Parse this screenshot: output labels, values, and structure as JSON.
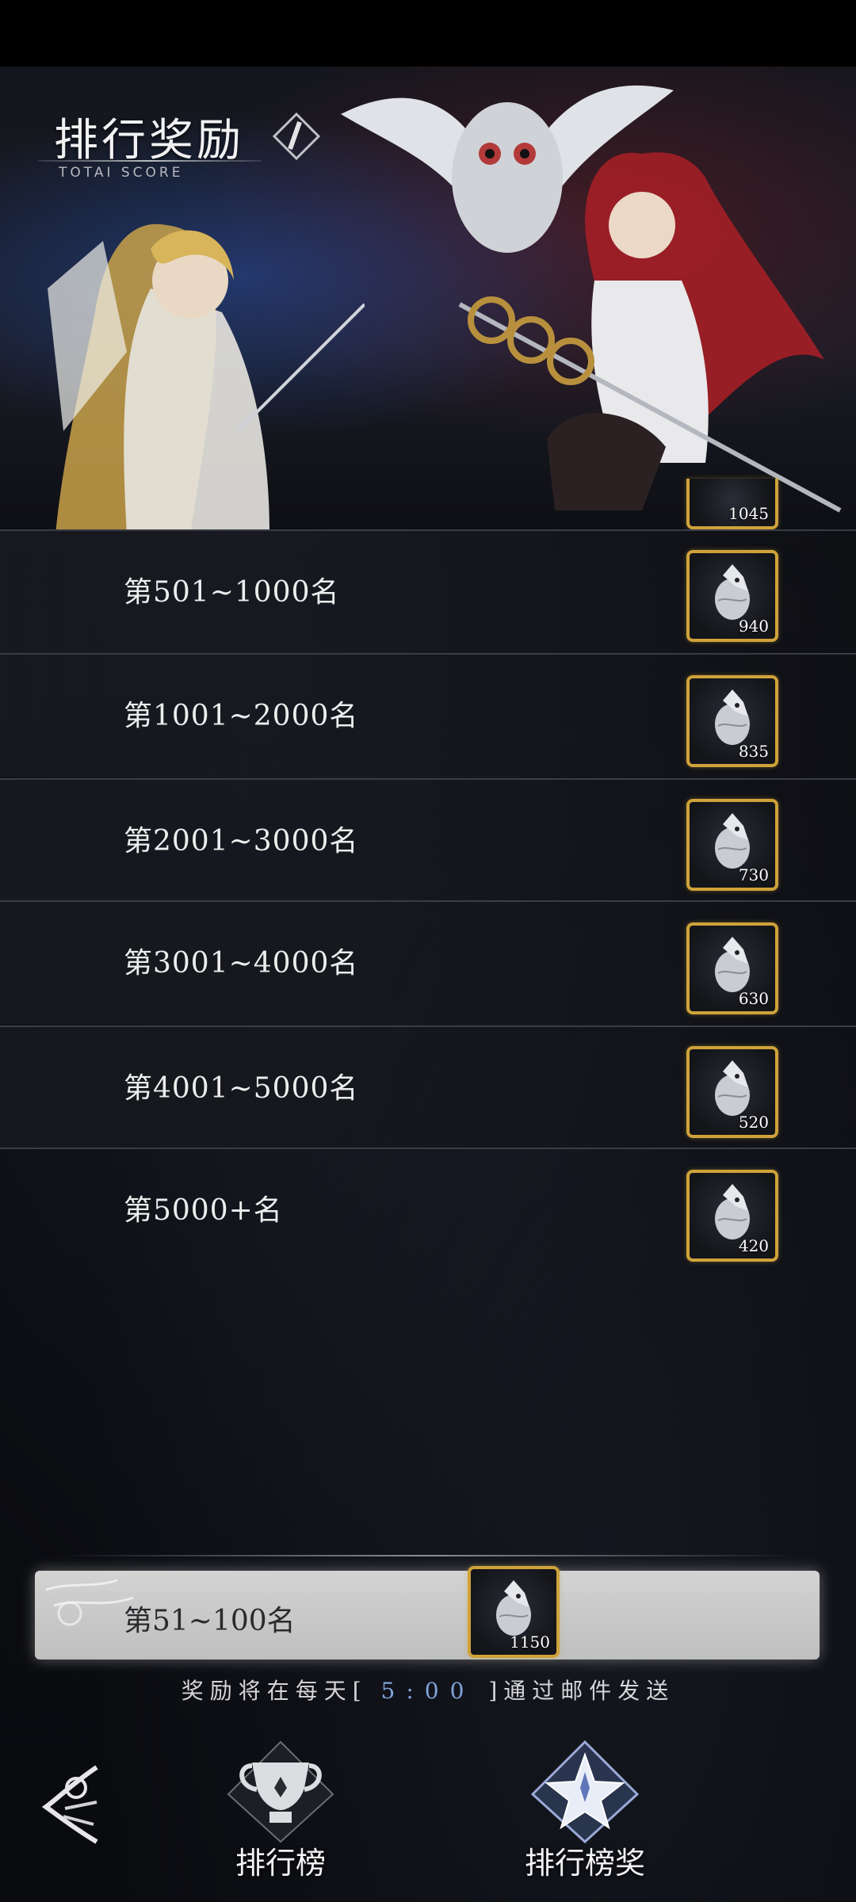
{
  "header": {
    "title": "排行奖励",
    "subtitle": "TOTAI SCORE"
  },
  "banner_reward": {
    "count": "1045"
  },
  "rows": [
    {
      "label": "第501~1000名",
      "count": "940"
    },
    {
      "label": "第1001~2000名",
      "count": "835"
    },
    {
      "label": "第2001~3000名",
      "count": "730"
    },
    {
      "label": "第3001~4000名",
      "count": "630"
    },
    {
      "label": "第4001~5000名",
      "count": "520"
    },
    {
      "label": "第5000+名",
      "count": "420"
    }
  ],
  "my_rank": {
    "label": "第51~100名",
    "count": "1150"
  },
  "notice": {
    "before": "奖励将在每天[",
    "time": "5:00",
    "after": "]通过邮件发送"
  },
  "nav": {
    "back_icon": "rose-back-icon",
    "tab_ranking": "排行榜",
    "tab_rewards": "排行榜奖"
  },
  "colors": {
    "reward_border": "#cfa23a",
    "time_highlight": "#7fa4d8"
  }
}
